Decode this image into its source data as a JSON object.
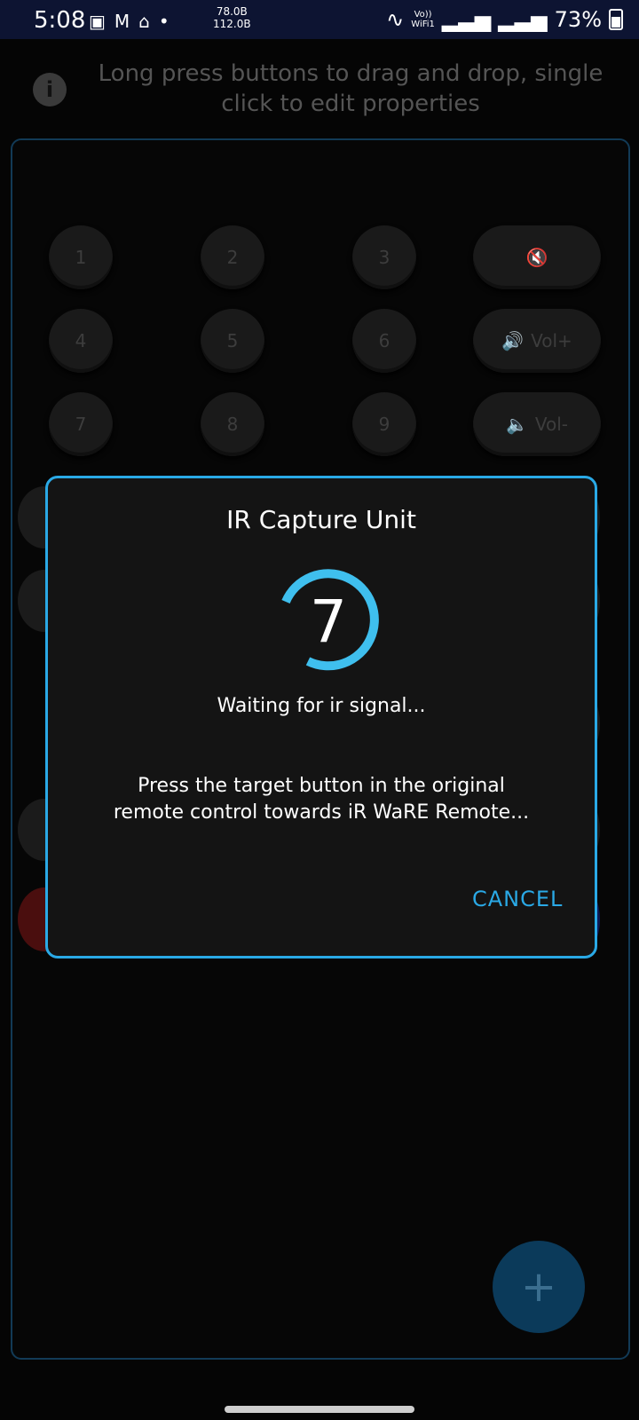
{
  "status_bar": {
    "time": "5:08",
    "net_up": "78.0B",
    "net_down": "112.0B",
    "volte_label": "Vo))",
    "wifi_label": "WiFi1",
    "battery": "73%"
  },
  "hint": "Long press buttons to drag and drop, single click to edit properties",
  "remote": {
    "keys": [
      "1",
      "2",
      "3",
      "4",
      "5",
      "6",
      "7",
      "8",
      "9"
    ],
    "vol_up_label": "Vol+",
    "vol_down_label": "Vol-"
  },
  "dialog": {
    "title": "IR Capture Unit",
    "countdown": "7",
    "status": "Waiting for ir signal...",
    "instruction": "Press the target button in the original remote control towards iR WaRE Remote...",
    "cancel_label": "CANCEL"
  },
  "fab_label": "+",
  "colors": {
    "accent": "#2aa9e6",
    "fab": "#0b3a5a"
  }
}
